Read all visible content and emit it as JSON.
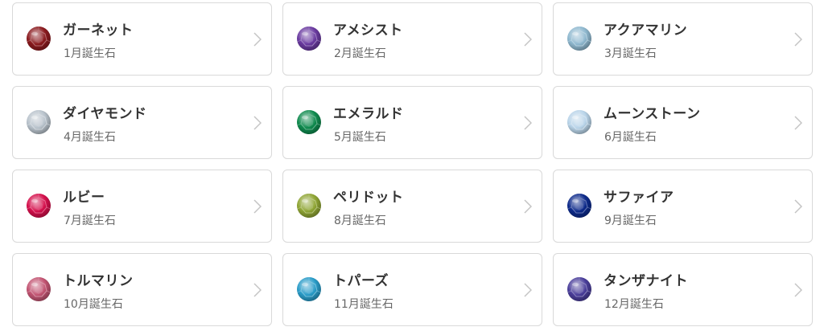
{
  "cards": [
    {
      "name": "ガーネット",
      "month": "1月誕生石",
      "color": "#8a1a1e",
      "icon": "garnet-icon"
    },
    {
      "name": "アメシスト",
      "month": "2月誕生石",
      "color": "#6a3aa0",
      "icon": "amethyst-icon"
    },
    {
      "name": "アクアマリン",
      "month": "3月誕生石",
      "color": "#8fb8cf",
      "icon": "aquamarine-icon"
    },
    {
      "name": "ダイヤモンド",
      "month": "4月誕生石",
      "color": "#b9c3cc",
      "icon": "diamond-icon"
    },
    {
      "name": "エメラルド",
      "month": "5月誕生石",
      "color": "#0f8a4e",
      "icon": "emerald-icon"
    },
    {
      "name": "ムーンストーン",
      "month": "6月誕生石",
      "color": "#b9d4e9",
      "icon": "moonstone-icon"
    },
    {
      "name": "ルビー",
      "month": "7月誕生石",
      "color": "#d5104c",
      "icon": "ruby-icon"
    },
    {
      "name": "ペリドット",
      "month": "8月誕生石",
      "color": "#8fa534",
      "icon": "peridot-icon"
    },
    {
      "name": "サファイア",
      "month": "9月誕生石",
      "color": "#0d2a8a",
      "icon": "sapphire-icon"
    },
    {
      "name": "トルマリン",
      "month": "10月誕生石",
      "color": "#c25472",
      "icon": "tourmaline-icon"
    },
    {
      "name": "トパーズ",
      "month": "11月誕生石",
      "color": "#2a9cc8",
      "icon": "topaz-icon"
    },
    {
      "name": "タンザナイト",
      "month": "12月誕生石",
      "color": "#4a3e9a",
      "icon": "tanzanite-icon"
    }
  ],
  "chevron_icon": "chevron-right-icon",
  "colors": {
    "card_border": "#d9d9d9",
    "title_text": "#333333",
    "sub_text": "#666666",
    "chevron": "#c4c4c4"
  }
}
